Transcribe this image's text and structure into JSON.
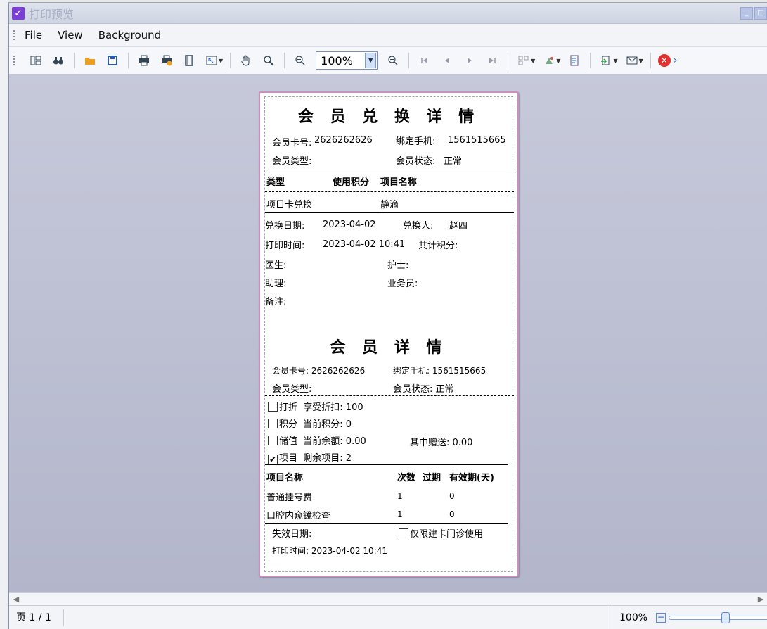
{
  "window": {
    "title": "打印预览"
  },
  "menu": [
    "File",
    "View",
    "Background"
  ],
  "toolbar": {
    "zoom_value": "100%"
  },
  "receipt": {
    "exchange": {
      "title": "会 员 兑 换 详 情",
      "card_label": "会员卡号:",
      "card_no": "2626262626",
      "phone_label": "绑定手机:",
      "phone": "1561515665",
      "type_label": "会员类型:",
      "status_label": "会员状态:",
      "status": "正常",
      "col_type": "类型",
      "col_points": "使用积分",
      "col_item": "项目名称",
      "row_type": "项目卡兑换",
      "row_item": "静滴",
      "date_label": "兑换日期:",
      "date": "2023-04-02",
      "person_label": "兑换人:",
      "person": "赵四",
      "print_label": "打印时间:",
      "print_time": "2023-04-02 10:41",
      "total_label": "共计积分:",
      "doctor_label": "医生:",
      "nurse_label": "护士:",
      "assistant_label": "助理:",
      "sales_label": "业务员:",
      "remark_label": "备注:"
    },
    "member": {
      "title": "会 员 详 情",
      "card_line": "会员卡号: 2626262626",
      "phone_line": "绑定手机: 1561515665",
      "type_label": "会员类型:",
      "status_line": "会员状态: 正常",
      "discount_label": "打折",
      "discount_text": "享受折扣: 100",
      "points_label": "积分",
      "points_text": "当前积分: 0",
      "stored_label": "储值",
      "balance_text": "当前余额: 0.00",
      "gift_text": "其中赠送: 0.00",
      "item_label": "项目",
      "remaining_text": "剩余项目: 2",
      "check_mark": "✔",
      "col_name": "项目名称",
      "col_count": "次数",
      "col_expired": "过期",
      "col_valid": "有效期(天)",
      "rows": [
        {
          "name": "普通挂号费",
          "count": "1",
          "expired": "0"
        },
        {
          "name": "口腔内窥镜检查",
          "count": "1",
          "expired": "0"
        }
      ],
      "expire_label": "失效日期:",
      "only_card_label": "仅限建卡门诊使用",
      "print_line": "打印时间: 2023-04-02 10:41"
    }
  },
  "status": {
    "page": "页 1 / 1",
    "zoom": "100%"
  }
}
